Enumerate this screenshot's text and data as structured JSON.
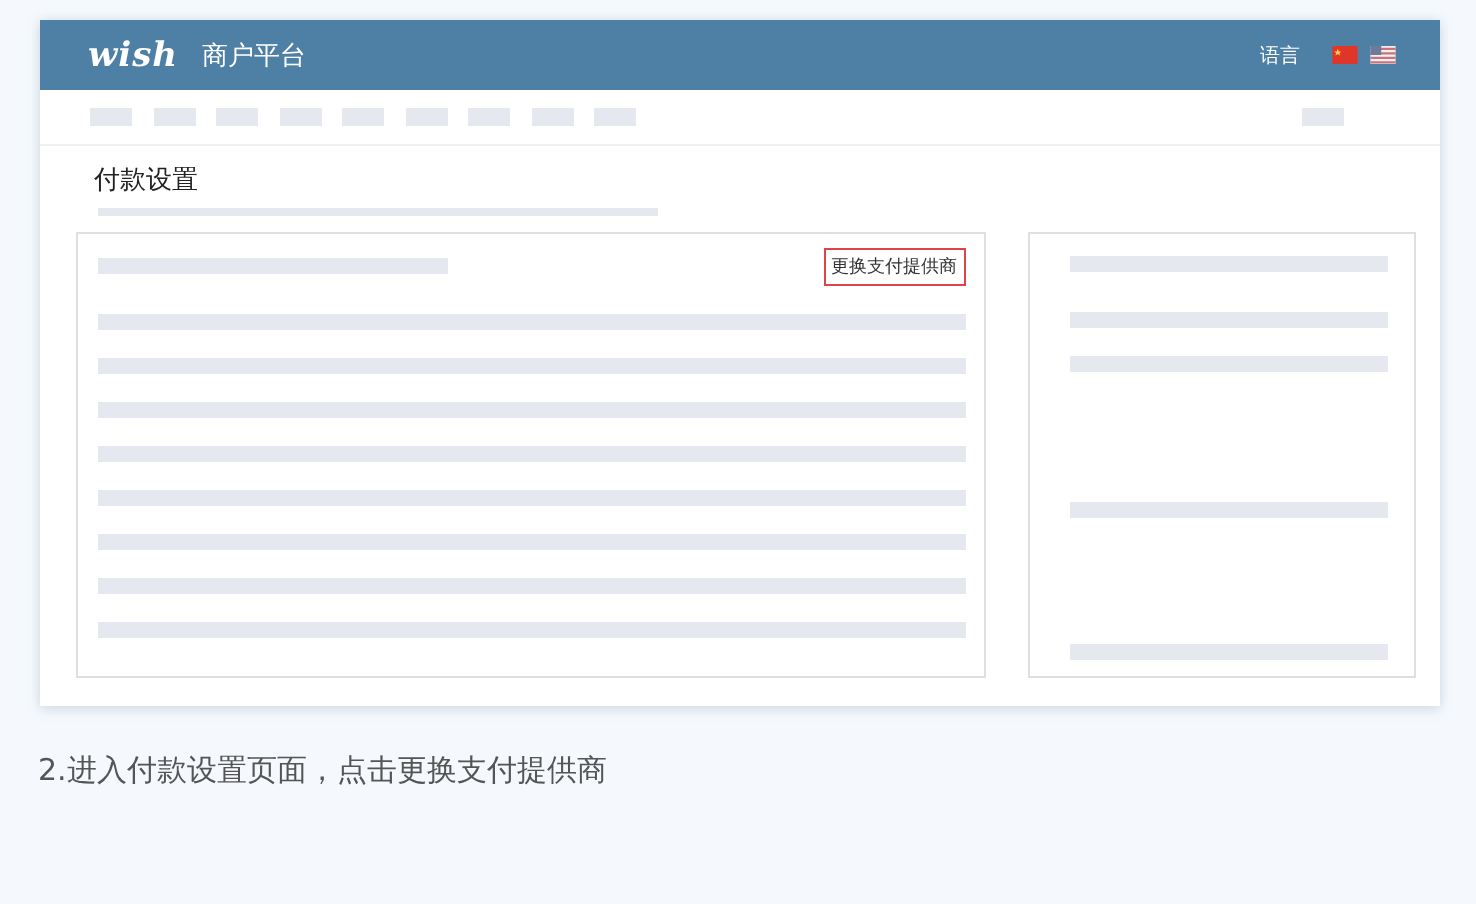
{
  "header": {
    "logo": "wish",
    "title": "商户平台",
    "language_label": "语言"
  },
  "page": {
    "title": "付款设置",
    "action_button": "更换支付提供商"
  },
  "caption": "2.进入付款设置页面，点击更换支付提供商"
}
